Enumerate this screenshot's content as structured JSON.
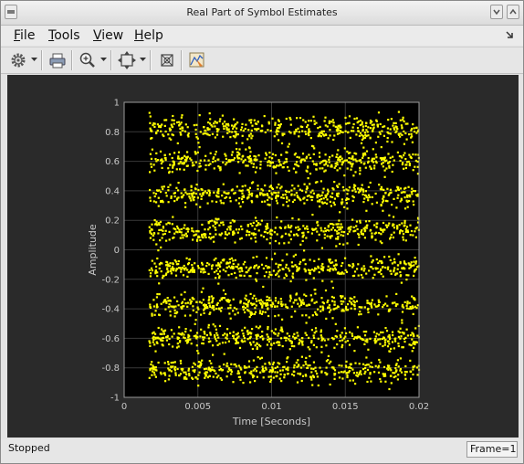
{
  "window": {
    "title": "Real Part of Symbol Estimates"
  },
  "menubar": {
    "items": [
      {
        "label": "File",
        "mnemonic": "F",
        "rest": "ile"
      },
      {
        "label": "Tools",
        "mnemonic": "T",
        "rest": "ools"
      },
      {
        "label": "View",
        "mnemonic": "V",
        "rest": "iew"
      },
      {
        "label": "Help",
        "mnemonic": "H",
        "rest": "elp"
      }
    ]
  },
  "toolbar": {
    "icons": [
      "gear-icon",
      "printer-icon",
      "zoom-in-icon",
      "autoscale-icon",
      "restore-view-icon",
      "highlight-icon"
    ]
  },
  "status": {
    "text": "Stopped",
    "frame": "Frame=1"
  },
  "colors": {
    "plot_background": "#2a2a2a",
    "axes_background": "#000000",
    "marker": "#ffff00",
    "grid": "#3a3a3a"
  },
  "chart_data": {
    "type": "scatter",
    "xlabel": "Time [Seconds]",
    "ylabel": "Amplitude",
    "xlim": [
      0,
      0.02
    ],
    "ylim": [
      -1,
      1
    ],
    "x_ticks": [
      "0",
      "0.005",
      "0.01",
      "0.015",
      "0.02"
    ],
    "y_ticks": [
      "1",
      "0.8",
      "0.6",
      "0.4",
      "0.2",
      "0",
      "-0.2",
      "-0.4",
      "-0.6",
      "-0.8",
      "-1"
    ],
    "grid": true,
    "marker_color": "#ffff00",
    "data_start_time": 0.0017,
    "data_end_time": 0.02,
    "symbol_levels": [
      0.82,
      0.6,
      0.37,
      0.13,
      -0.13,
      -0.37,
      -0.6,
      -0.82
    ],
    "level_spread": 0.04,
    "points_per_level": 420
  }
}
